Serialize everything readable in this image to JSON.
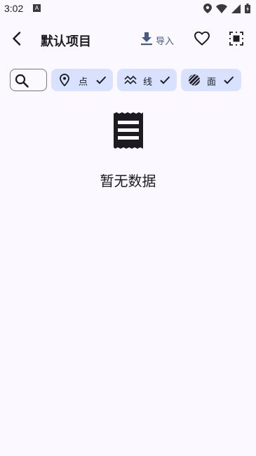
{
  "status_bar": {
    "time": "3:02",
    "notification_badge": "A",
    "icons": [
      "location-icon",
      "wifi-icon",
      "signal-icon",
      "battery-icon"
    ]
  },
  "app_bar": {
    "title": "默认项目",
    "import_label": "导入",
    "icons": [
      "back-arrow-icon",
      "download-icon",
      "heart-icon",
      "select-all-icon"
    ]
  },
  "filters": {
    "chips": [
      {
        "label": "点",
        "icon": "location-pin-icon",
        "selected": true
      },
      {
        "label": "线",
        "icon": "polyline-icon",
        "selected": true
      },
      {
        "label": "面",
        "icon": "polygon-hatch-icon",
        "selected": true
      }
    ]
  },
  "empty_state": {
    "message": "暂无数据",
    "icon": "receipt-icon"
  },
  "colors": {
    "background": "#fbf8ff",
    "chip_bg": "#d8e2ff",
    "accent": "#455a85",
    "text": "#1c1b1f"
  }
}
